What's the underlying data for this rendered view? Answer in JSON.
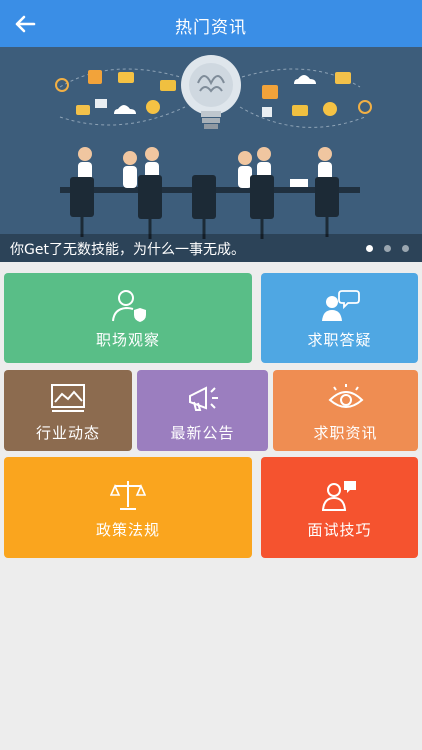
{
  "header": {
    "title": "热门资讯"
  },
  "banner": {
    "caption": "你Get了无数技能，为什么一事无成。",
    "active_slide": 1,
    "slide_count": 3
  },
  "tiles": [
    {
      "label": "职场观察",
      "color": "#59be87",
      "icon": "user-shield-icon"
    },
    {
      "label": "求职答疑",
      "color": "#4fa7e3",
      "icon": "user-chat-icon"
    },
    {
      "label": "行业动态",
      "color": "#8c6b4f",
      "icon": "line-chart-icon"
    },
    {
      "label": "最新公告",
      "color": "#9b7ebf",
      "icon": "megaphone-icon"
    },
    {
      "label": "求职资讯",
      "color": "#ef8d52",
      "icon": "eye-icon"
    },
    {
      "label": "政策法规",
      "color": "#faa51e",
      "icon": "scales-icon"
    },
    {
      "label": "面试技巧",
      "color": "#f5532f",
      "icon": "interview-icon"
    }
  ]
}
